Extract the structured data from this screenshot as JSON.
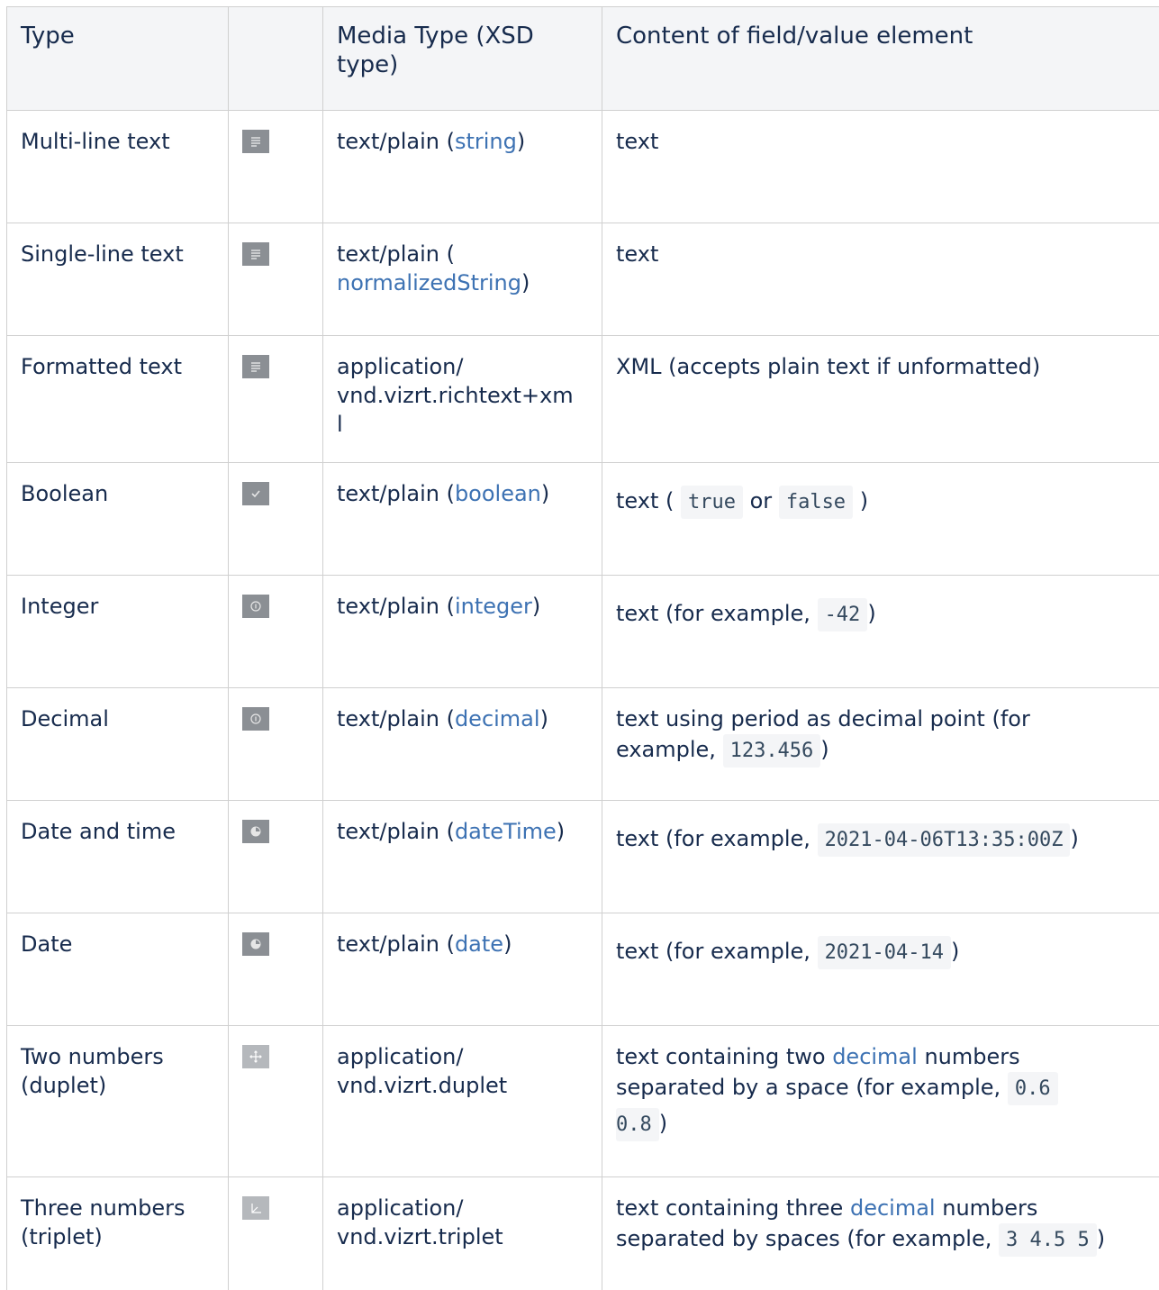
{
  "headers": {
    "type": "Type",
    "icon": "",
    "media_type": "Media Type (XSD type)",
    "content": "Content of field/value element"
  },
  "rows": [
    {
      "type": "Multi-line text",
      "icon": "text-lines-icon",
      "media_prefix": "text/plain (",
      "media_link": "string",
      "media_suffix": ")",
      "content_text": "text"
    },
    {
      "type": "Single-line text",
      "icon": "text-lines-icon",
      "media_prefix": "text/plain (",
      "media_link": "normalizedString",
      "media_suffix": ")",
      "content_text": "text"
    },
    {
      "type": "Formatted text",
      "icon": "text-lines-icon",
      "media_line1": "application/",
      "media_line2": "vnd.vizrt.richtext+xm",
      "media_line3": "l",
      "content_text": "XML (accepts plain text if unformatted)"
    },
    {
      "type": "Boolean",
      "icon": "checkmark-icon",
      "media_prefix": "text/plain (",
      "media_link": "boolean",
      "media_suffix": ")",
      "content_prefix": "text (",
      "code1": "true",
      "content_mid": "or",
      "code2": "false",
      "content_suffix": ")"
    },
    {
      "type": "Integer",
      "icon": "number-icon",
      "media_prefix": "text/plain (",
      "media_link": "integer",
      "media_suffix": ")",
      "content_prefix": "text (for example,",
      "code1": "-42",
      "content_suffix": ")"
    },
    {
      "type": "Decimal",
      "icon": "number-icon",
      "media_prefix": "text/plain (",
      "media_link": "decimal",
      "media_suffix": ")",
      "content_line1": "text using period as decimal point (for",
      "content_prefix": "example,",
      "code1": "123.456",
      "content_suffix": ")"
    },
    {
      "type": "Date and time",
      "icon": "clock-icon",
      "media_prefix": "text/plain (",
      "media_link": "dateTime",
      "media_suffix": ")",
      "content_prefix": "text (for example,",
      "code1": "2021-04-06T13:35:00Z",
      "content_suffix": ")"
    },
    {
      "type": "Date",
      "icon": "clock-icon",
      "media_prefix": "text/plain (",
      "media_link": "date",
      "media_suffix": ")",
      "content_prefix": "text (for example,",
      "code1": "2021-04-14",
      "content_suffix": ")"
    },
    {
      "type_line1": "Two numbers",
      "type_line2": "(duplet)",
      "icon": "move-arrows-icon",
      "media_line1": "application/",
      "media_line2": "vnd.vizrt.duplet",
      "content_prefix": "text containing two",
      "content_link": "decimal",
      "content_after_link": "numbers",
      "content_line2": "separated by a space (for example,",
      "code1": "0.6",
      "code2": "0.8",
      "content_suffix": ")"
    },
    {
      "type_line1": "Three numbers",
      "type_line2": "(triplet)",
      "icon": "axes-icon",
      "media_line1": "application/",
      "media_line2": "vnd.vizrt.triplet",
      "content_prefix": "text containing three",
      "content_link": "decimal",
      "content_after_link": "numbers",
      "content_line2": "separated by spaces (for example,",
      "code1": "3 4.5 5",
      "content_suffix": ")"
    }
  ]
}
